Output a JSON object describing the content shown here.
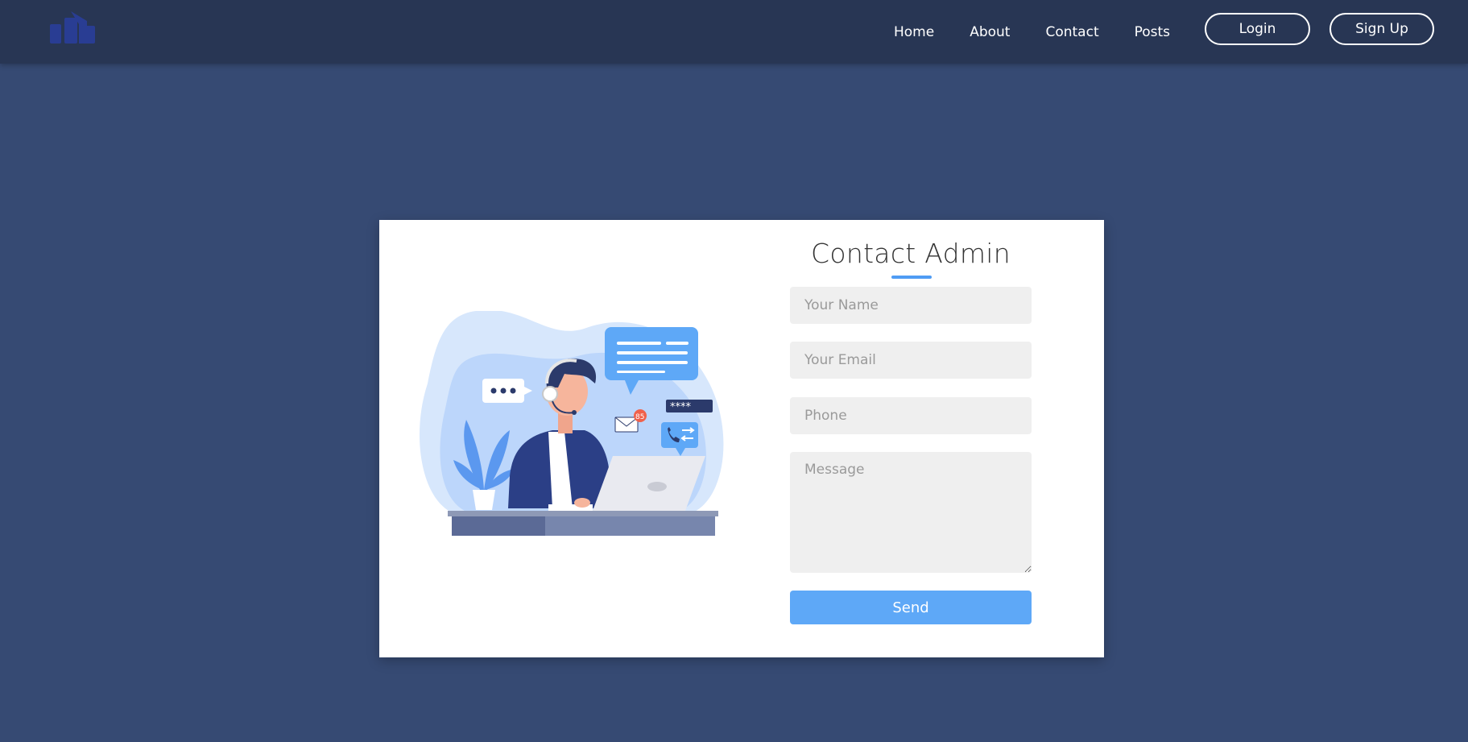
{
  "nav": {
    "logo": "site-logo",
    "links": [
      "Home",
      "About",
      "Contact",
      "Posts"
    ],
    "login_label": "Login",
    "signup_label": "Sign Up"
  },
  "contact": {
    "title": "Contact Admin",
    "name_placeholder": "Your Name",
    "email_placeholder": "Your Email",
    "phone_placeholder": "Phone",
    "message_placeholder": "Message",
    "send_label": "Send",
    "illustration": {
      "badge_count": "85",
      "password_mask": "****",
      "accent_color": "#5ea8f7"
    }
  },
  "colors": {
    "background": "#364a73",
    "navbar": "#283654",
    "accent": "#5ea8f7"
  }
}
